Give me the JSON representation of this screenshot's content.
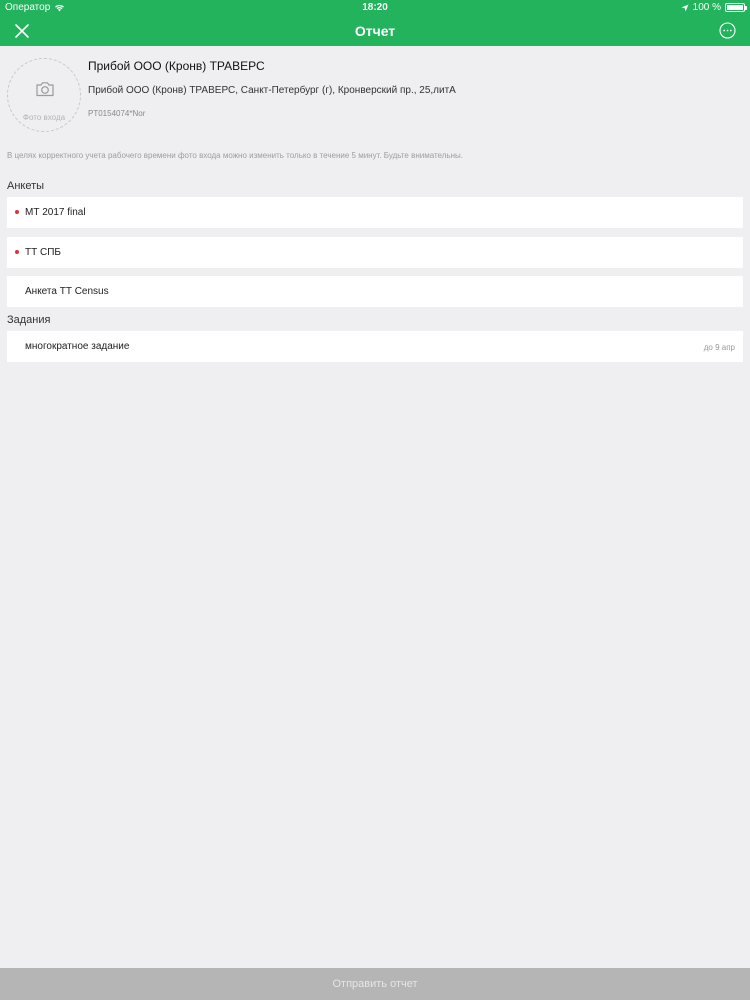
{
  "status_bar": {
    "carrier": "Оператор",
    "time": "18:20",
    "battery": "100 %"
  },
  "nav": {
    "title": "Отчет"
  },
  "header": {
    "photo_label": "Фото входа",
    "shop_name": "Прибой ООО (Кронв) ТРАВЕРС",
    "shop_address": "Прибой ООО (Кронв) ТРАВЕРС, Санкт-Петербург (г), Кронверский пр., 25,литА",
    "shop_code": "PT0154074*Nor"
  },
  "notice": "В целях корректного учета рабочего времени фото входа можно изменить только в течение 5 минут. Будьте внимательны.",
  "surveys": {
    "title": "Анкеты",
    "items": [
      {
        "label": "МТ 2017 final"
      },
      {
        "label": "ТТ СПБ"
      },
      {
        "label": "Анкета ТТ Census"
      }
    ]
  },
  "tasks": {
    "title": "Задания",
    "items": [
      {
        "label": "многократное задание",
        "due": "до 9 апр"
      }
    ]
  },
  "footer": {
    "submit_label": "Отправить отчет"
  },
  "colors": {
    "brand": "#22b35c",
    "required_dot": "#d9313d",
    "background": "#efeff1",
    "disabled_button": "#b5b5b5"
  },
  "icons": {
    "close": "close-icon",
    "more": "more-icon",
    "camera": "camera-icon",
    "wifi": "wifi-icon",
    "location": "location-arrow-icon",
    "battery": "battery-icon"
  }
}
